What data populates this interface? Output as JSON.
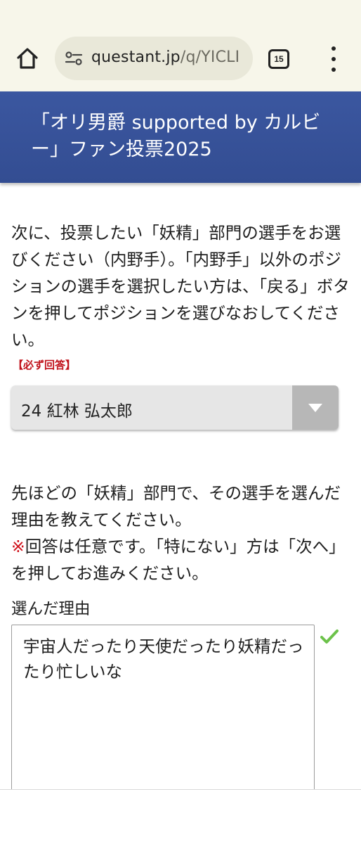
{
  "browser": {
    "url_host": "questant.jp",
    "url_path": "/q/YICLI",
    "tab_count": "15"
  },
  "survey": {
    "title": "「オリ男爵 supported by カルビー」ファン投票2025"
  },
  "question1": {
    "text": "次に、投票したい「妖精」部門の選手をお選びください（内野手）。「内野手」以外のポジションの選手を選択したい方は、「戻る」ボタンを押してポジションを選びなおしてください。",
    "required_label": "【必ず回答】",
    "selected_value": "24 紅林 弘太郎"
  },
  "question2": {
    "text": "先ほどの「妖精」部門で、その選手を選んだ理由を教えてください。",
    "note_mark": "※",
    "note": "回答は任意です。「特にない」方は「次へ」を押してお進みください。",
    "field_label": "選んだ理由",
    "answer": "宇宙人だったり天使だったり妖精だったり忙しいな"
  },
  "colors": {
    "chrome_bg": "#f7f6ea",
    "header_bg": "#3b57a0",
    "required": "#c0121b",
    "check": "#6cc24a"
  },
  "icons": [
    "home-icon",
    "site-info-icon",
    "tabs-icon",
    "more-vert-icon",
    "dropdown-arrow-icon",
    "checkmark-icon"
  ]
}
